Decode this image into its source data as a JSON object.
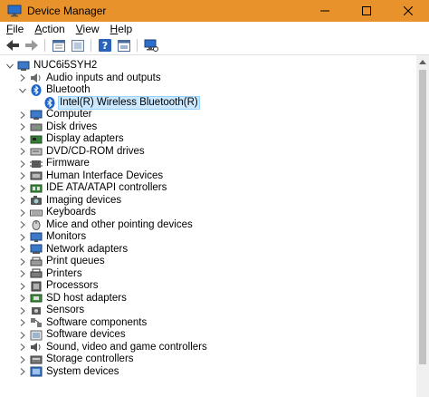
{
  "window": {
    "title": "Device Manager"
  },
  "menu": [
    {
      "prefix": "",
      "ul": "F",
      "rest": "ile"
    },
    {
      "prefix": "",
      "ul": "A",
      "rest": "ction"
    },
    {
      "prefix": "",
      "ul": "V",
      "rest": "iew"
    },
    {
      "prefix": "",
      "ul": "H",
      "rest": "elp"
    }
  ],
  "toolbar": [
    "back-icon",
    "forward-icon",
    "properties-icon",
    "show-hidden-icon",
    "help-icon",
    "update-driver-icon",
    "scan-changes-icon"
  ],
  "tree": {
    "root": "NUC6i5SYH2",
    "items": [
      {
        "label": "Audio inputs and outputs",
        "icon": "audio-icon",
        "expanded": false
      },
      {
        "label": "Bluetooth",
        "icon": "bluetooth-icon",
        "expanded": true,
        "children": [
          {
            "label": "Intel(R) Wireless Bluetooth(R)",
            "icon": "bluetooth-icon",
            "selected": true
          }
        ]
      },
      {
        "label": "Computer",
        "icon": "computer-icon",
        "expanded": false
      },
      {
        "label": "Disk drives",
        "icon": "disk-drive-icon",
        "expanded": false
      },
      {
        "label": "Display adapters",
        "icon": "display-adapter-icon",
        "expanded": false
      },
      {
        "label": "DVD/CD-ROM drives",
        "icon": "dvd-drive-icon",
        "expanded": false
      },
      {
        "label": "Firmware",
        "icon": "firmware-icon",
        "expanded": false
      },
      {
        "label": "Human Interface Devices",
        "icon": "hid-icon",
        "expanded": false
      },
      {
        "label": "IDE ATA/ATAPI controllers",
        "icon": "ide-controller-icon",
        "expanded": false
      },
      {
        "label": "Imaging devices",
        "icon": "camera-icon",
        "expanded": false
      },
      {
        "label": "Keyboards",
        "icon": "keyboard-icon",
        "expanded": false
      },
      {
        "label": "Mice and other pointing devices",
        "icon": "mouse-icon",
        "expanded": false
      },
      {
        "label": "Monitors",
        "icon": "monitor-icon",
        "expanded": false
      },
      {
        "label": "Network adapters",
        "icon": "network-adapter-icon",
        "expanded": false
      },
      {
        "label": "Print queues",
        "icon": "print-queue-icon",
        "expanded": false
      },
      {
        "label": "Printers",
        "icon": "printer-icon",
        "expanded": false
      },
      {
        "label": "Processors",
        "icon": "processor-icon",
        "expanded": false
      },
      {
        "label": "SD host adapters",
        "icon": "sd-host-icon",
        "expanded": false
      },
      {
        "label": "Sensors",
        "icon": "sensor-icon",
        "expanded": false
      },
      {
        "label": "Software components",
        "icon": "software-component-icon",
        "expanded": false
      },
      {
        "label": "Software devices",
        "icon": "software-device-icon",
        "expanded": false
      },
      {
        "label": "Sound, video and game controllers",
        "icon": "sound-icon",
        "expanded": false
      },
      {
        "label": "Storage controllers",
        "icon": "storage-controller-icon",
        "expanded": false
      },
      {
        "label": "System devices",
        "icon": "system-device-icon",
        "expanded": false
      }
    ]
  },
  "colors": {
    "titlebar": "#e8922c",
    "selection": "#cce8ff",
    "selection_border": "#99d1ff"
  }
}
